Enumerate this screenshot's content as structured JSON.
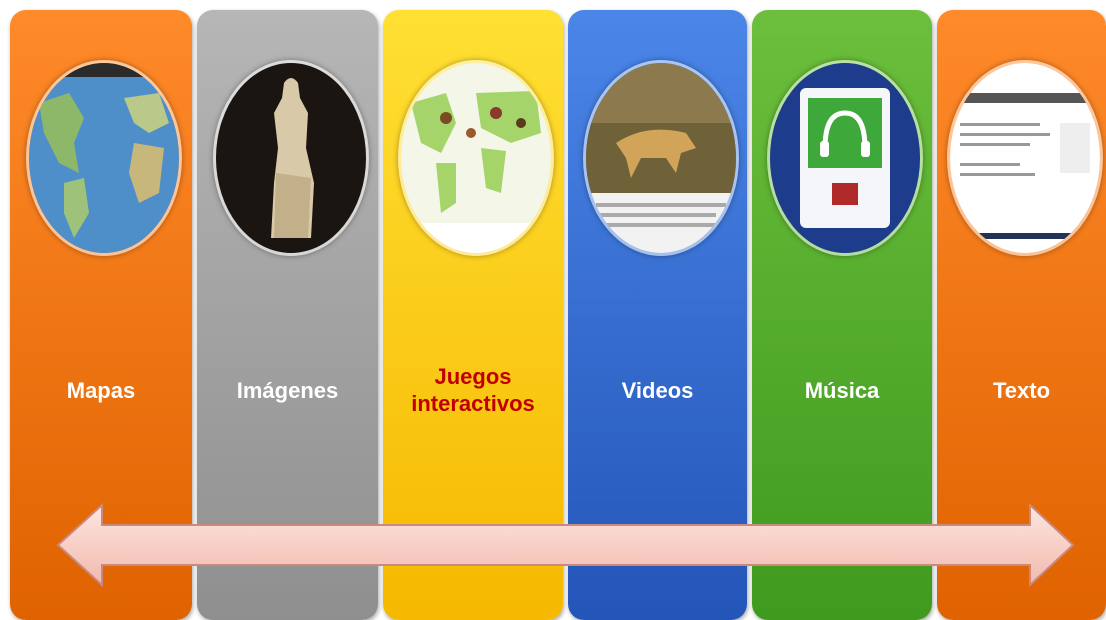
{
  "columns": [
    {
      "id": "mapas",
      "label": "Mapas",
      "color_top": "#ff8a2a",
      "color_bottom": "#e06200",
      "label_color": "#ffffff",
      "icon": "world-map-thumbnail"
    },
    {
      "id": "imagenes",
      "label": "Imágenes",
      "color_top": "#b6b6b6",
      "color_bottom": "#8f8f8f",
      "label_color": "#ffffff",
      "icon": "statue-photo-thumbnail"
    },
    {
      "id": "juegos",
      "label": "Juegos\ninteractivos",
      "color_top": "#ffe033",
      "color_bottom": "#f6b800",
      "label_color": "#c00000",
      "icon": "instrument-map-thumbnail"
    },
    {
      "id": "videos",
      "label": "Videos",
      "color_top": "#4a86e8",
      "color_bottom": "#2455b8",
      "label_color": "#ffffff",
      "icon": "cheetah-video-thumbnail"
    },
    {
      "id": "musica",
      "label": "Música",
      "color_top": "#6cbf3c",
      "color_bottom": "#3f9a1e",
      "label_color": "#ffffff",
      "icon": "headphones-thumbnail"
    },
    {
      "id": "texto",
      "label": "Texto",
      "color_top": "#ff8a2a",
      "color_bottom": "#e06200",
      "label_color": "#ffffff",
      "icon": "text-page-thumbnail"
    }
  ],
  "arrow": {
    "fill_top": "#fde6e1",
    "fill_bottom": "#f2b9ad",
    "stroke": "#c9897c",
    "direction": "both"
  }
}
